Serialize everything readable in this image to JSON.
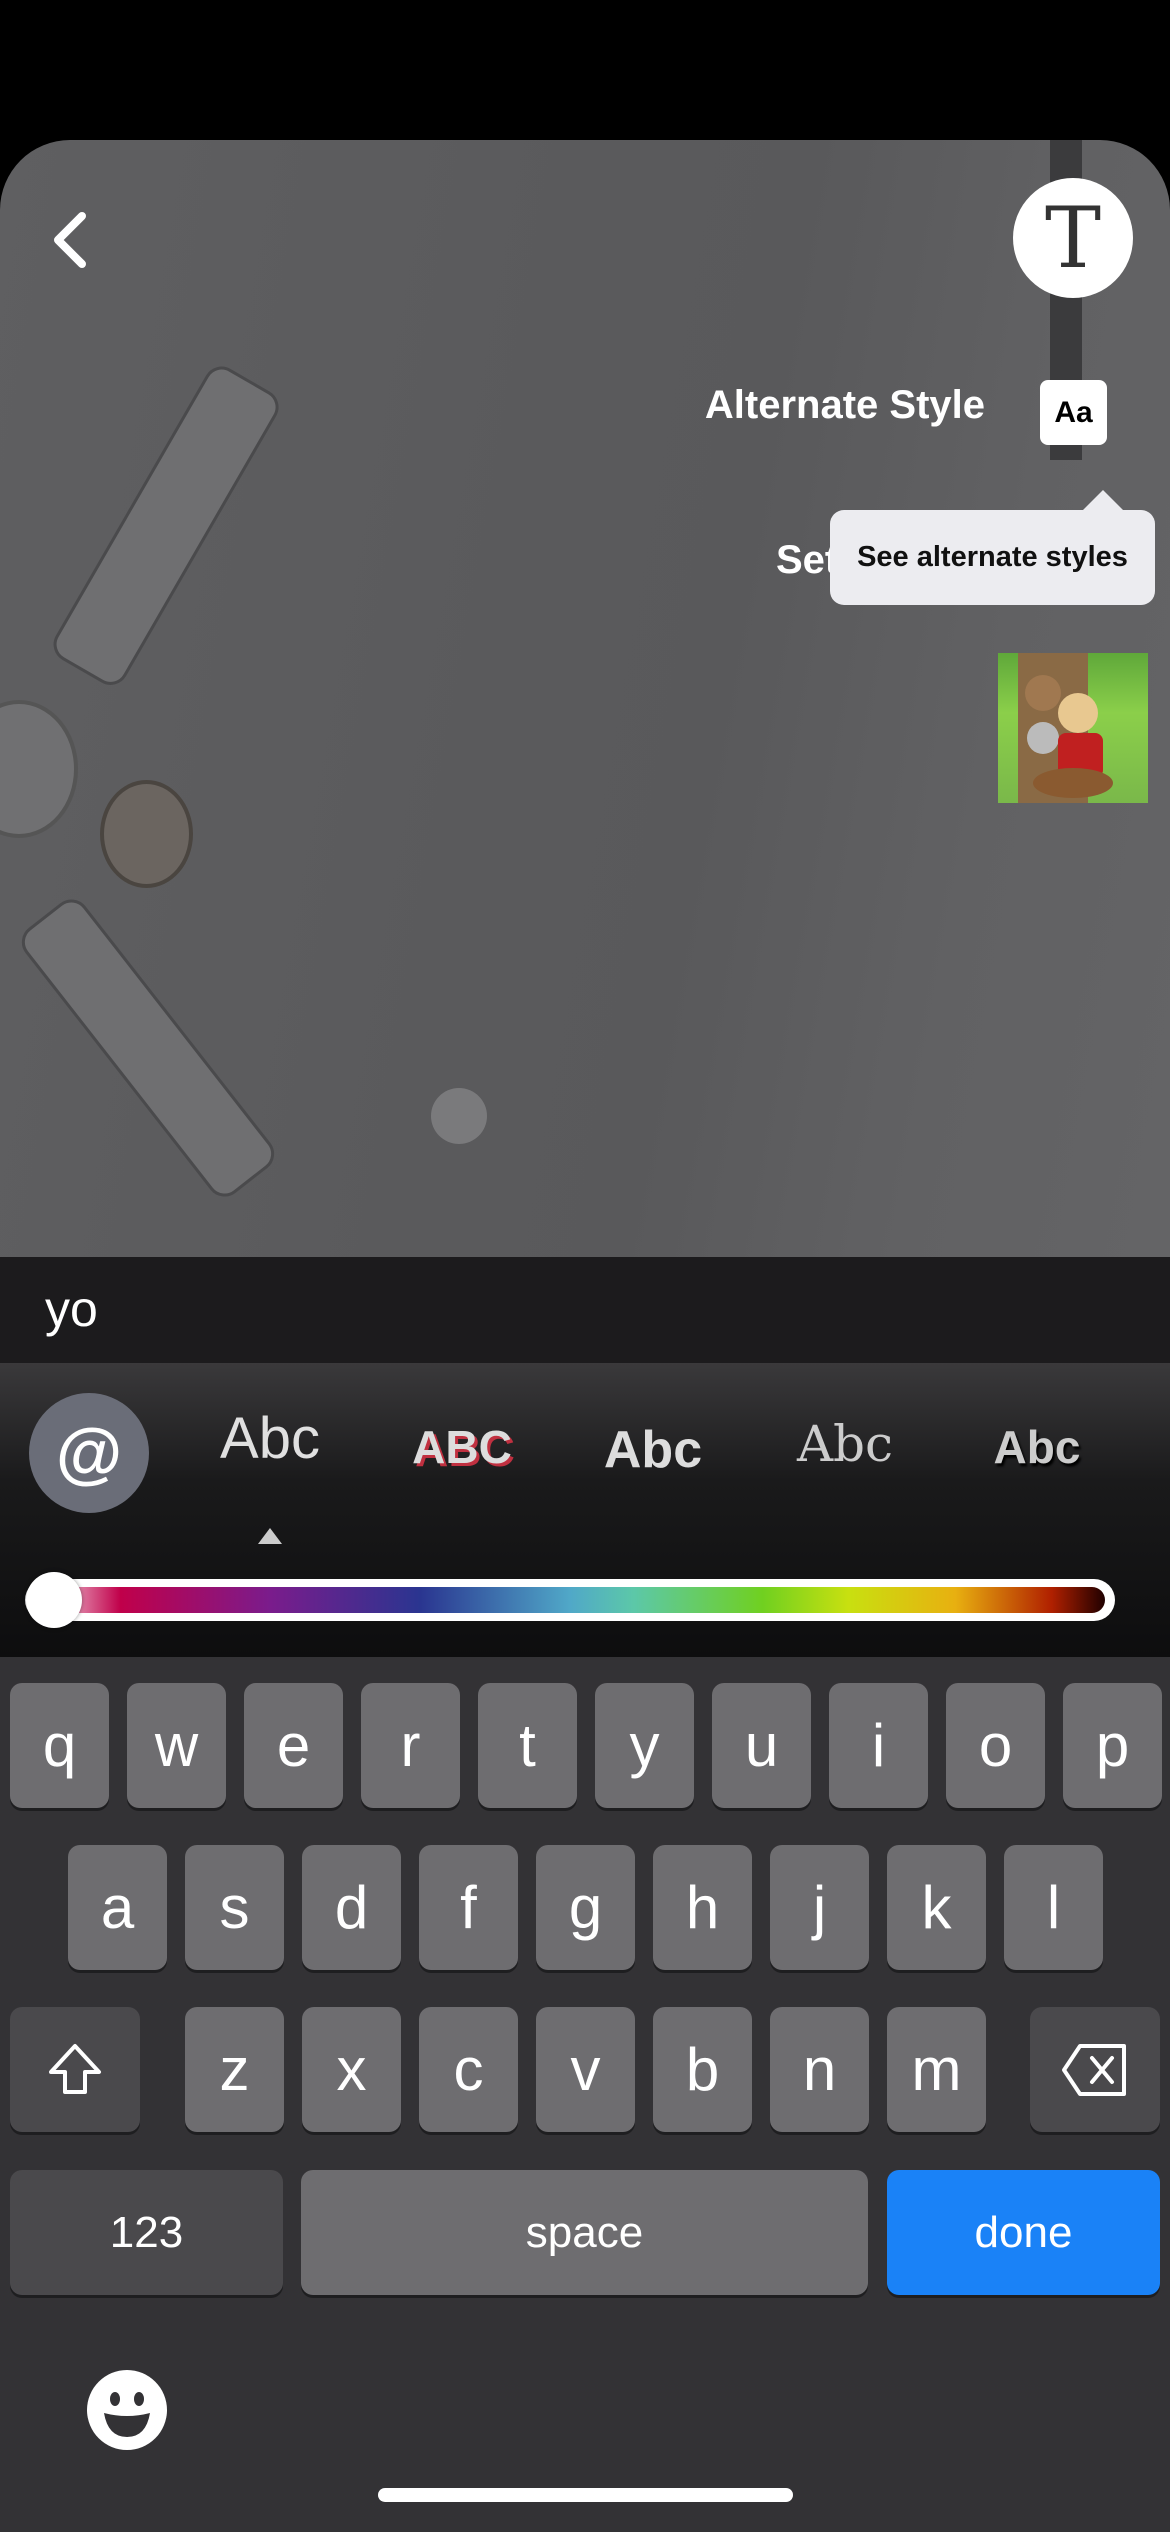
{
  "header": {
    "back_icon": "chevron-left-icon",
    "text_tool_label": "T"
  },
  "menu": {
    "alternate_style_label": "Alternate Style",
    "alternate_style_badge": "Aa",
    "set_label_partial": "Set",
    "tooltip": "See alternate styles"
  },
  "caption": {
    "value": "yo"
  },
  "styles": {
    "mention_label": "@",
    "items": [
      "Abc",
      "ABC",
      "Abc",
      "Abc",
      "Abc"
    ],
    "selected_index": 0
  },
  "color_slider": {
    "value_percent": 0
  },
  "keyboard": {
    "row1": [
      "q",
      "w",
      "e",
      "r",
      "t",
      "y",
      "u",
      "i",
      "o",
      "p"
    ],
    "row2": [
      "a",
      "s",
      "d",
      "f",
      "g",
      "h",
      "j",
      "k",
      "l"
    ],
    "row3": [
      "z",
      "x",
      "c",
      "v",
      "b",
      "n",
      "m"
    ],
    "numbers_label": "123",
    "space_label": "space",
    "done_label": "done",
    "accent_color": "#1a82f7"
  }
}
